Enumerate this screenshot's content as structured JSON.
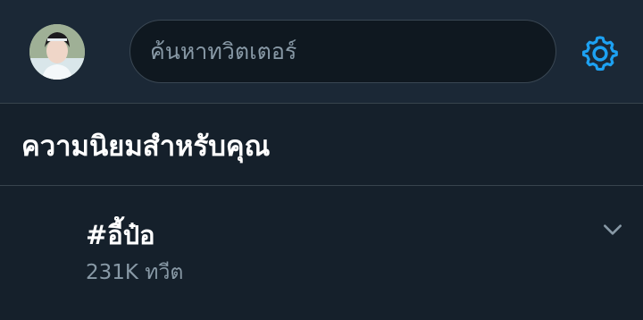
{
  "header": {
    "search": {
      "placeholder": "ค้นหาทวิตเตอร์",
      "value": ""
    },
    "avatar_icon": "profile-avatar",
    "settings_icon": "gear-icon"
  },
  "section": {
    "title": "ความนิยมสำหรับคุณ"
  },
  "trends": [
    {
      "name": "#อี้ป๋อ",
      "count": "231K ทวีต",
      "menu_icon": "chevron-down-icon"
    }
  ],
  "colors": {
    "background": "#15202b",
    "header": "#1b2836",
    "accent": "#1da1f2",
    "secondary_text": "#8899a6"
  }
}
